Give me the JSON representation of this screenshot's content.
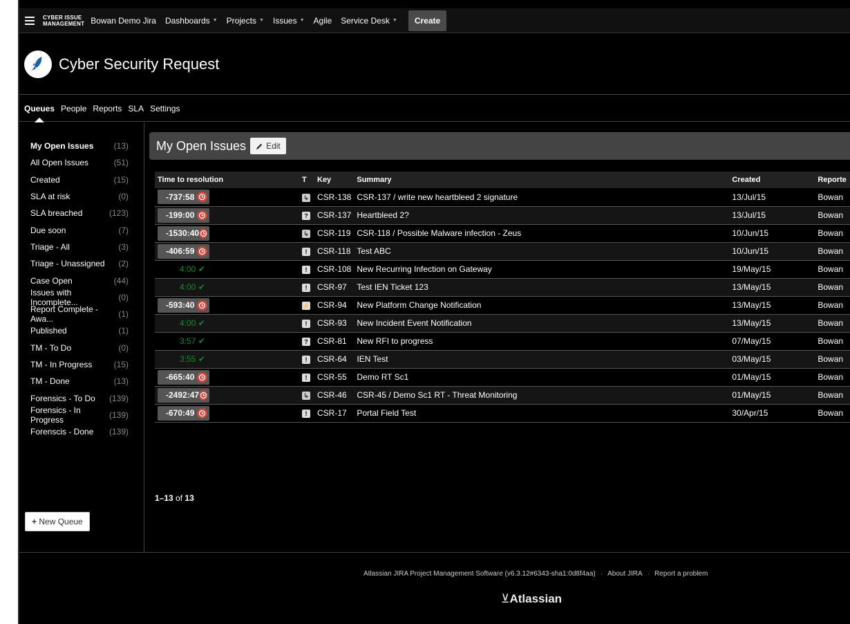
{
  "topnav": {
    "logo_line1": "CYBER ISSUE",
    "logo_line2": "MANAGEMENT",
    "items": [
      {
        "label": "Bowan Demo Jira",
        "caret": false
      },
      {
        "label": "Dashboards",
        "caret": true
      },
      {
        "label": "Projects",
        "caret": true
      },
      {
        "label": "Issues",
        "caret": true
      },
      {
        "label": "Agile",
        "caret": false
      },
      {
        "label": "Service Desk",
        "caret": true
      }
    ],
    "create_label": "Create"
  },
  "project": {
    "title": "Cyber Security Request"
  },
  "subnav": {
    "tabs": [
      "Queues",
      "People",
      "Reports",
      "SLA",
      "Settings"
    ],
    "active": "Queues"
  },
  "sidebar": {
    "queues": [
      {
        "name": "My Open Issues",
        "count": "(13)"
      },
      {
        "name": "All Open Issues",
        "count": "(51)"
      },
      {
        "name": "Created",
        "count": "(15)"
      },
      {
        "name": "SLA at risk",
        "count": "(0)"
      },
      {
        "name": "SLA breached",
        "count": "(123)"
      },
      {
        "name": "Due soon",
        "count": "(7)"
      },
      {
        "name": "Triage - All",
        "count": "(3)"
      },
      {
        "name": "Triage - Unassigned",
        "count": "(2)"
      },
      {
        "name": "Case Open",
        "count": "(44)"
      },
      {
        "name": "Issues with Incomplete...",
        "count": "(0)"
      },
      {
        "name": "Report Complete - Awa...",
        "count": "(1)"
      },
      {
        "name": "Published",
        "count": "(1)"
      },
      {
        "name": "TM - To Do",
        "count": "(0)"
      },
      {
        "name": "TM - In Progress",
        "count": "(15)"
      },
      {
        "name": "TM - Done",
        "count": "(13)"
      },
      {
        "name": "Forensics - To Do",
        "count": "(139)"
      },
      {
        "name": "Forensics - In Progress",
        "count": "(139)"
      },
      {
        "name": "Forenscis - Done",
        "count": "(139)"
      }
    ],
    "new_queue_label": "New Queue"
  },
  "main": {
    "title": "My Open Issues",
    "edit_label": "Edit",
    "columns": [
      "Time to resolution",
      "T",
      "Key",
      "Summary",
      "Created",
      "Reporte"
    ],
    "rows": [
      {
        "time": "-737:58",
        "status": "breached",
        "type": "sub",
        "key": "CSR-138",
        "summary": "CSR-137 / write new heartbleed 2 signature",
        "created": "13/Jul/15",
        "reporter": "Bowan"
      },
      {
        "time": "-199:00",
        "status": "breached",
        "type": "q",
        "key": "CSR-137",
        "summary": "Heartbleed 2?",
        "created": "13/Jul/15",
        "reporter": "Bowan"
      },
      {
        "time": "-1530:40",
        "status": "breached",
        "type": "sub",
        "key": "CSR-119",
        "summary": "CSR-118 / Possible Malware infection - Zeus",
        "created": "10/Jun/15",
        "reporter": "Bowan"
      },
      {
        "time": "-406:59",
        "status": "breached",
        "type": "issue",
        "key": "CSR-118",
        "summary": "Test ABC",
        "created": "10/Jun/15",
        "reporter": "Bowan"
      },
      {
        "time": "4:00",
        "status": "ok",
        "type": "issue",
        "key": "CSR-108",
        "summary": "New Recurring Infection on Gateway",
        "created": "19/May/15",
        "reporter": "Bowan"
      },
      {
        "time": "4:00",
        "status": "ok",
        "type": "issue",
        "key": "CSR-97",
        "summary": "Test IEN Ticket 123",
        "created": "13/May/15",
        "reporter": "Bowan"
      },
      {
        "time": "-593:40",
        "status": "breached",
        "type": "plat",
        "key": "CSR-94",
        "summary": "New Platform Change Notification",
        "created": "13/May/15",
        "reporter": "Bowan"
      },
      {
        "time": "4:00",
        "status": "ok",
        "type": "issue",
        "key": "CSR-93",
        "summary": "New Incident Event Notification",
        "created": "13/May/15",
        "reporter": "Bowan"
      },
      {
        "time": "3:57",
        "status": "ok",
        "type": "q",
        "key": "CSR-81",
        "summary": "New RFI to progress",
        "created": "07/May/15",
        "reporter": "Bowan"
      },
      {
        "time": "3:55",
        "status": "ok",
        "type": "issue",
        "key": "CSR-64",
        "summary": "IEN Test",
        "created": "03/May/15",
        "reporter": "Bowan"
      },
      {
        "time": "-665:40",
        "status": "breached",
        "type": "issue",
        "key": "CSR-55",
        "summary": "Demo RT Sc1",
        "created": "01/May/15",
        "reporter": "Bowan"
      },
      {
        "time": "-2492:47",
        "status": "breached",
        "type": "sub",
        "key": "CSR-46",
        "summary": "CSR-45 / Demo Sc1 RT - Threat Monitoring",
        "created": "01/May/15",
        "reporter": "Bowan"
      },
      {
        "time": "-670:49",
        "status": "breached",
        "type": "issue",
        "key": "CSR-17",
        "summary": "Portal Field Test",
        "created": "30/Apr/15",
        "reporter": "Bowan"
      }
    ],
    "pager_range": "1–13",
    "pager_of": "of",
    "pager_total": "13"
  },
  "footer": {
    "software": "Atlassian JIRA Project Management Software (v6.3.12#6343-sha1:0d8f4aa)",
    "about": "About JIRA",
    "report": "Report a problem",
    "logo": "Atlassian"
  },
  "colors": {
    "breached": "#d04437",
    "ok": "#14892c"
  }
}
